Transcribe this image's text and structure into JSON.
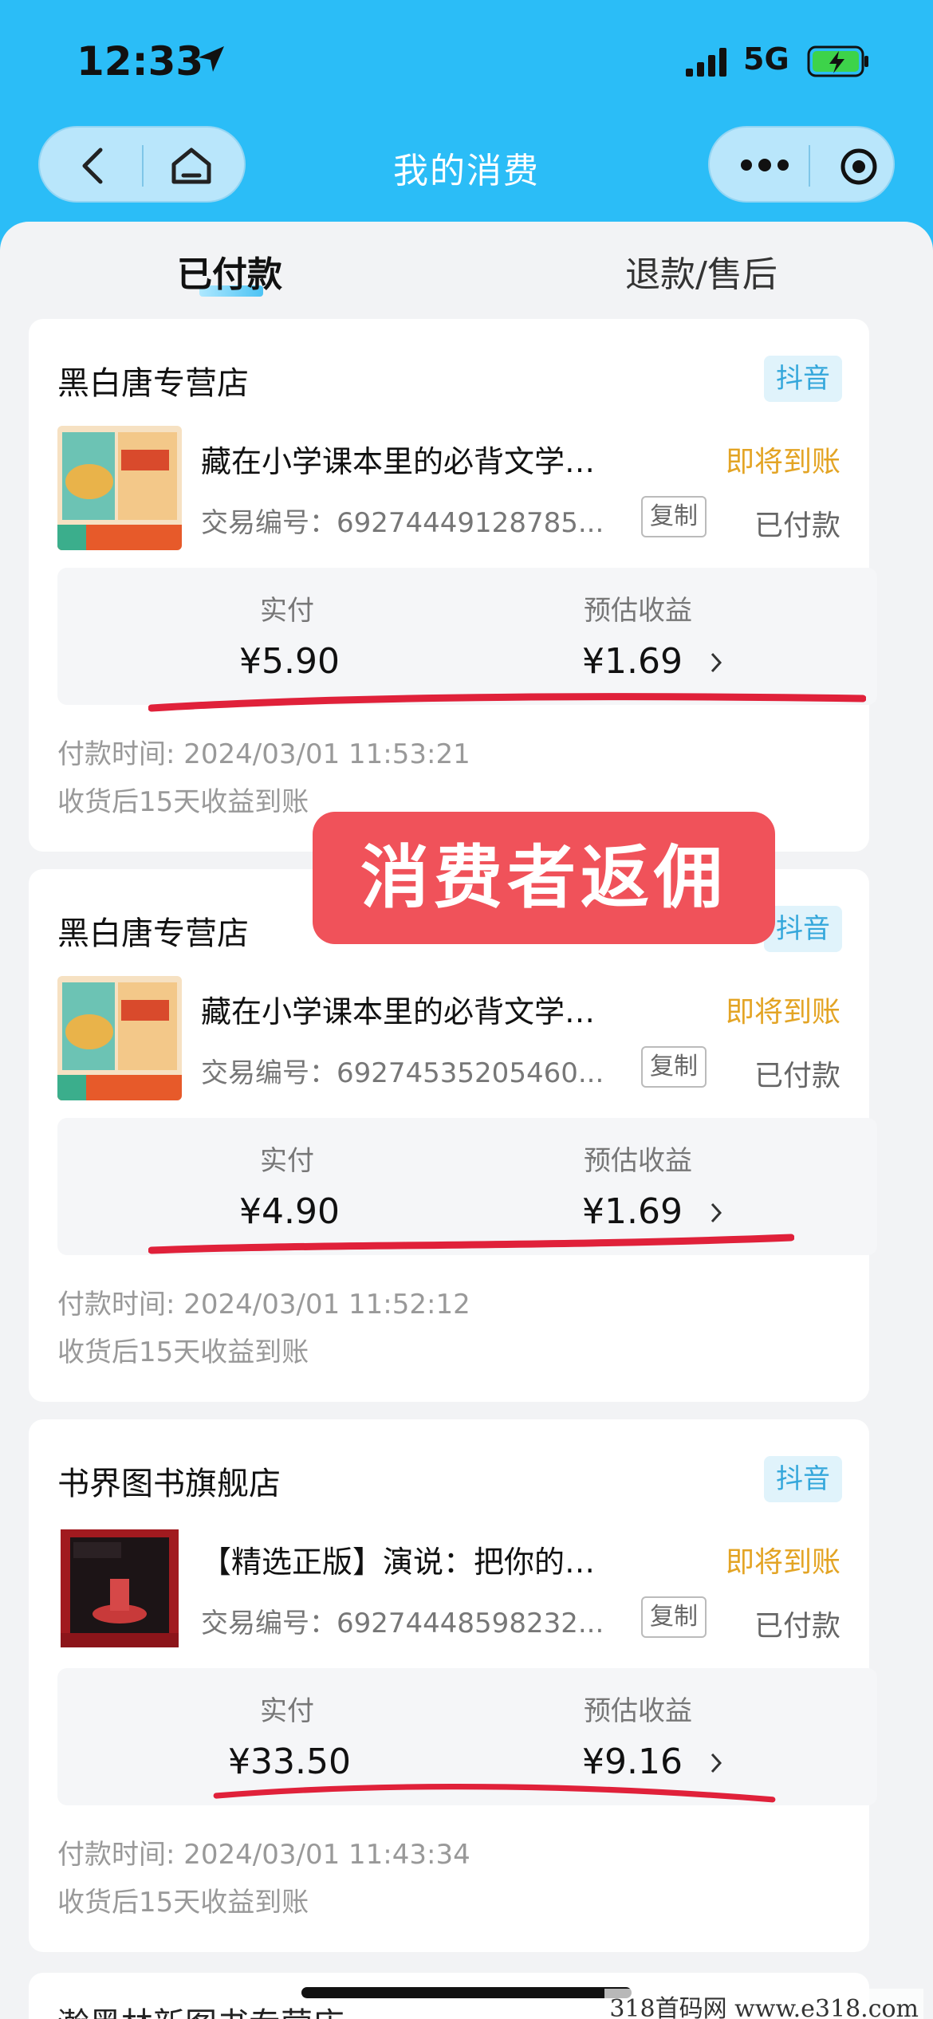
{
  "status_bar": {
    "time": "12:33",
    "network": "5G"
  },
  "nav": {
    "title": "我的消费"
  },
  "tabs": [
    {
      "label": "已付款",
      "active": true
    },
    {
      "label": "退款/售后",
      "active": false
    }
  ],
  "orders": [
    {
      "store": "黑白唐专营店",
      "platform": "抖音",
      "product_title": "藏在小学课本里的必背文学常识...",
      "status_arrive": "即将到账",
      "tx_label": "交易编号：",
      "tx_value": "69274449128785...",
      "copy_label": "复制",
      "paid_status": "已付款",
      "paid_label": "实付",
      "paid_value": "¥5.90",
      "earn_label": "预估收益",
      "earn_value": "¥1.69",
      "pay_time": "付款时间: 2024/03/01 11:53:21",
      "settle_note": "收货后15天收益到账"
    },
    {
      "store": "黑白唐专营店",
      "platform": "抖音",
      "product_title": "藏在小学课本里的必背文学常识...",
      "status_arrive": "即将到账",
      "tx_label": "交易编号：",
      "tx_value": "69274535205460...",
      "copy_label": "复制",
      "paid_status": "已付款",
      "paid_label": "实付",
      "paid_value": "¥4.90",
      "earn_label": "预估收益",
      "earn_value": "¥1.69",
      "pay_time": "付款时间: 2024/03/01 11:52:12",
      "settle_note": "收货后15天收益到账"
    },
    {
      "store": "书界图书旗舰店",
      "platform": "抖音",
      "product_title": "【精选正版】演说：把你的思想...",
      "status_arrive": "即将到账",
      "tx_label": "交易编号：",
      "tx_value": "69274448598232...",
      "copy_label": "复制",
      "paid_status": "已付款",
      "paid_label": "实付",
      "paid_value": "¥33.50",
      "earn_label": "预估收益",
      "earn_value": "¥9.16",
      "pay_time": "付款时间: 2024/03/01 11:43:34",
      "settle_note": "收货后15天收益到账"
    }
  ],
  "overlay_text": "消费者返佣",
  "partial_store": "瀚黑林新图书专营店",
  "watermark": "318首码网 www.e318.com",
  "colors": {
    "header_bg": "#2bbdf7",
    "accent_orange": "#e3a424",
    "platform_blue": "#34a7db",
    "overlay_red": "#f0525a",
    "underline_red": "#e0213a"
  },
  "icons": {
    "back": "chevron-left-icon",
    "home": "home-icon",
    "more": "more-dots-icon",
    "close_target": "target-icon",
    "location": "location-arrow-icon",
    "signal": "signal-icon",
    "battery": "battery-charging-icon"
  }
}
